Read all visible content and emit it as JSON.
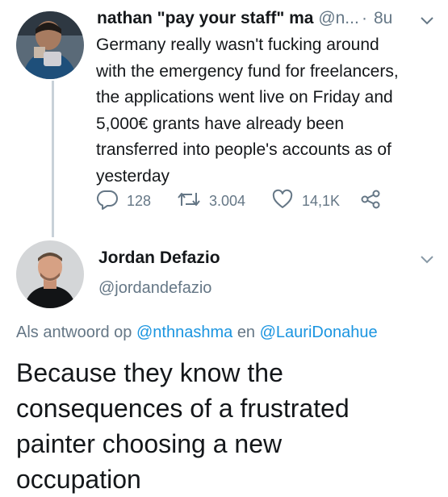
{
  "tweet1": {
    "author_name": "nathan \"pay your staff\" ma",
    "handle": "@n...",
    "separator": "·",
    "time": "8u",
    "lines": [
      "Germany really wasn't fucking around",
      "with the emergency fund for freelancers,",
      "the applications went live on Friday and",
      "5,000€ grants have already been",
      "transferred into people's accounts as of",
      "yesterday"
    ],
    "replies": "128",
    "retweets": "3.004",
    "likes": "14,1K"
  },
  "tweet2": {
    "author_name": "Jordan Defazio",
    "handle": "@jordandefazio",
    "reply_prefix": "Als antwoord op",
    "mention1": "@nthnashma",
    "conjunction": "en",
    "mention2": "@LauriDonahue",
    "lines": [
      "Because they know the",
      "consequences of a frustrated",
      "painter choosing a new",
      "occupation"
    ]
  },
  "colors": {
    "text": "#14171a",
    "muted": "#657786",
    "link": "#1b95e0",
    "thread_line": "#c8d1d8"
  },
  "icons": [
    "reply-icon",
    "retweet-icon",
    "like-icon",
    "share-icon",
    "chevron-down-icon"
  ]
}
